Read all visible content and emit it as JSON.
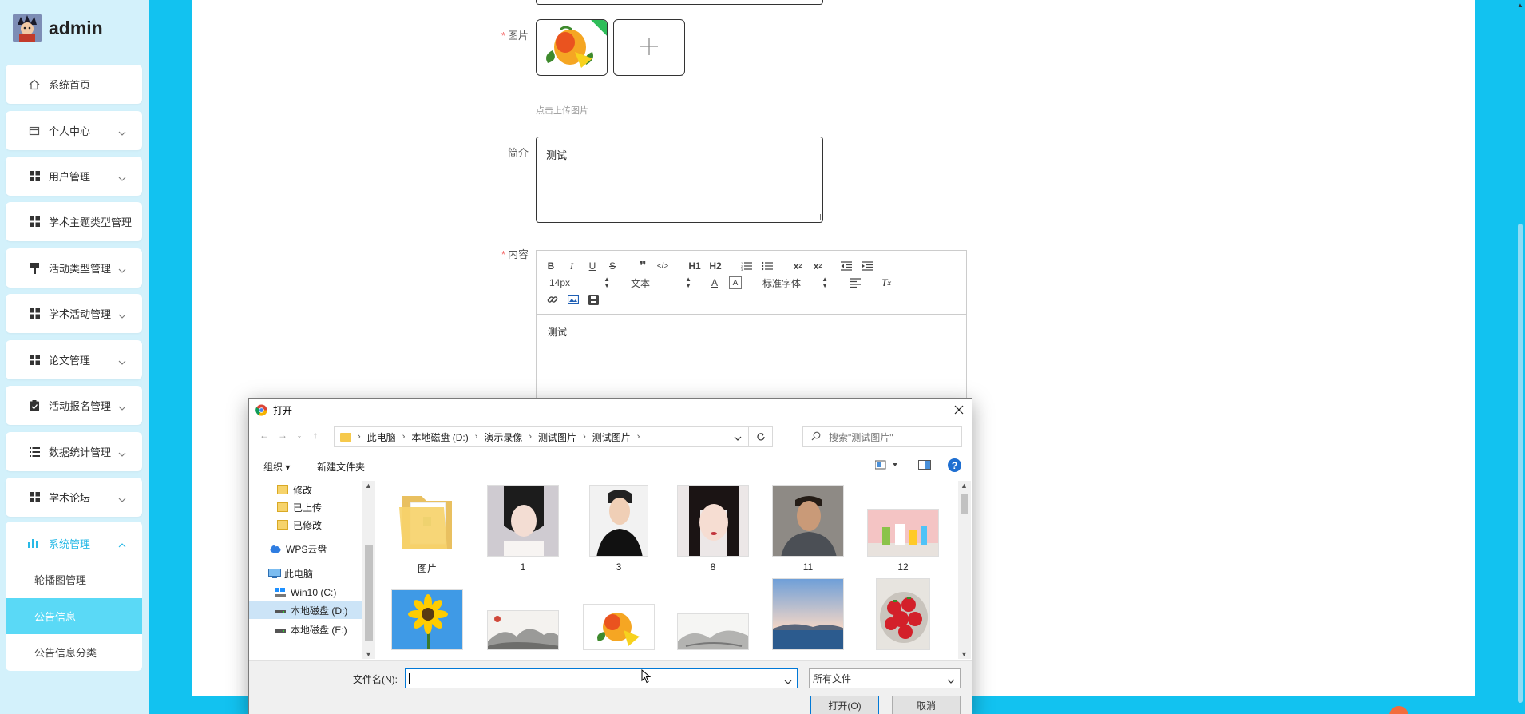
{
  "user": {
    "name": "admin"
  },
  "sidebar": {
    "items": [
      {
        "label": "系统首页",
        "icon": "home-icon"
      },
      {
        "label": "个人中心",
        "icon": "wallet-icon"
      },
      {
        "label": "用户管理",
        "icon": "grid-icon"
      },
      {
        "label": "学术主题类型管理",
        "icon": "grid-icon"
      },
      {
        "label": "活动类型管理",
        "icon": "brush-icon"
      },
      {
        "label": "学术活动管理",
        "icon": "grid-icon"
      },
      {
        "label": "论文管理",
        "icon": "grid-icon"
      },
      {
        "label": "活动报名管理",
        "icon": "clipboard-icon"
      },
      {
        "label": "数据统计管理",
        "icon": "list-icon"
      },
      {
        "label": "学术论坛",
        "icon": "grid-icon"
      }
    ],
    "group": {
      "label": "系统管理",
      "icon": "bar-chart-icon",
      "children": [
        "轮播图管理",
        "公告信息",
        "公告信息分类"
      ],
      "active_child": "公告信息"
    }
  },
  "form": {
    "image_label": "图片",
    "upload_hint": "点击上传图片",
    "intro_label": "简介",
    "intro_value": "测试",
    "content_label": "内容",
    "content_value": "测试"
  },
  "editor": {
    "font_size": "14px",
    "paragraph": "文本",
    "font_family": "标准字体",
    "h1": "H1",
    "h2": "H2"
  },
  "dialog": {
    "title": "打开",
    "breadcrumb": [
      "此电脑",
      "本地磁盘 (D:)",
      "演示录像",
      "测试图片",
      "测试图片"
    ],
    "search_placeholder": "搜索\"测试图片\"",
    "organize": "组织 ▾",
    "new_folder": "新建文件夹",
    "tree": [
      {
        "label": "修改",
        "icon": "folder-icon"
      },
      {
        "label": "已上传",
        "icon": "folder-icon"
      },
      {
        "label": "已修改",
        "icon": "folder-icon"
      },
      {
        "label": "WPS云盘",
        "icon": "cloud-icon"
      },
      {
        "label": "此电脑",
        "icon": "computer-icon"
      },
      {
        "label": "Win10 (C:)",
        "icon": "drive-icon"
      },
      {
        "label": "本地磁盘 (D:)",
        "icon": "drive-icon",
        "selected": true
      },
      {
        "label": "本地磁盘 (E:)",
        "icon": "drive-icon"
      }
    ],
    "files_row1": [
      "图片",
      "1",
      "3",
      "8",
      "11",
      "12"
    ],
    "files_row2": [
      "sunflower",
      "ink-landscape",
      "mango",
      "ink-landscape-2",
      "sea",
      "strawberries"
    ],
    "filename_label": "文件名(N):",
    "filename_value": "",
    "filetype": "所有文件",
    "open_btn": "打开(O)",
    "cancel_btn": "取消"
  },
  "colors": {
    "accent": "#29b9e6",
    "page_bg": "#12c2f0",
    "sidebar_bg": "#d3f1fb",
    "active_sub": "#5ad9f6"
  }
}
